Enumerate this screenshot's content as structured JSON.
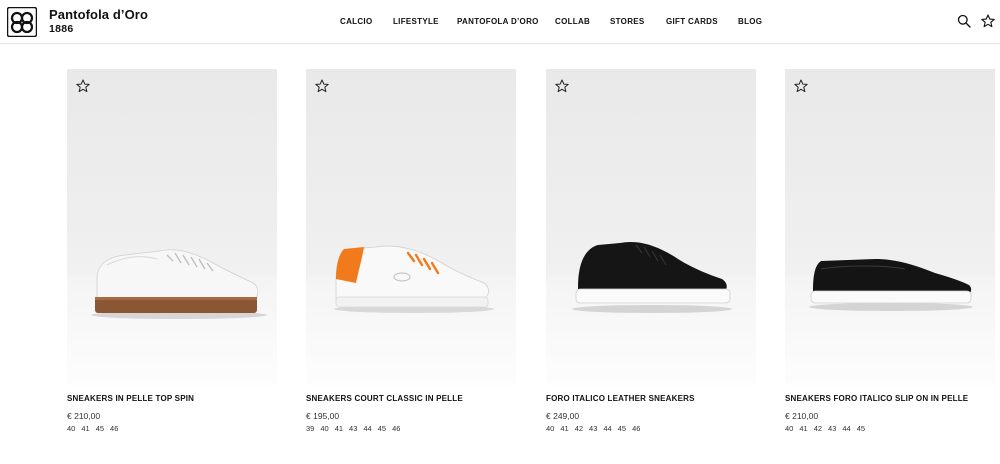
{
  "brand": {
    "name": "Pantofola d’Oro",
    "year": "1886"
  },
  "nav": {
    "items": [
      {
        "label": "CALCIO"
      },
      {
        "label": "LIFESTYLE"
      },
      {
        "label": "PANTOFOLA D’ORO"
      },
      {
        "label": "COLLAB"
      },
      {
        "label": "STORES"
      },
      {
        "label": "GIFT CARDS"
      },
      {
        "label": "BLOG"
      }
    ]
  },
  "header_icons": [
    "search-icon",
    "star-icon"
  ],
  "products": [
    {
      "name": "SNEAKERS IN PELLE TOP SPIN",
      "price": "€ 210,00",
      "sizes": [
        "40",
        "41",
        "45",
        "46"
      ],
      "wishlist_icon": "star-outline-icon"
    },
    {
      "name": "SNEAKERS COURT CLASSIC IN PELLE",
      "price": "€ 195,00",
      "sizes": [
        "39",
        "40",
        "41",
        "43",
        "44",
        "45",
        "46"
      ],
      "wishlist_icon": "star-outline-icon"
    },
    {
      "name": "FORO ITALICO LEATHER SNEAKERS",
      "price": "€ 249,00",
      "sizes": [
        "40",
        "41",
        "42",
        "43",
        "44",
        "45",
        "46"
      ],
      "wishlist_icon": "star-outline-icon"
    },
    {
      "name": "SNEAKERS FORO ITALICO SLIP ON IN PELLE",
      "price": "€ 210,00",
      "sizes": [
        "40",
        "41",
        "42",
        "43",
        "44",
        "45"
      ],
      "wishlist_icon": "star-outline-icon"
    }
  ]
}
